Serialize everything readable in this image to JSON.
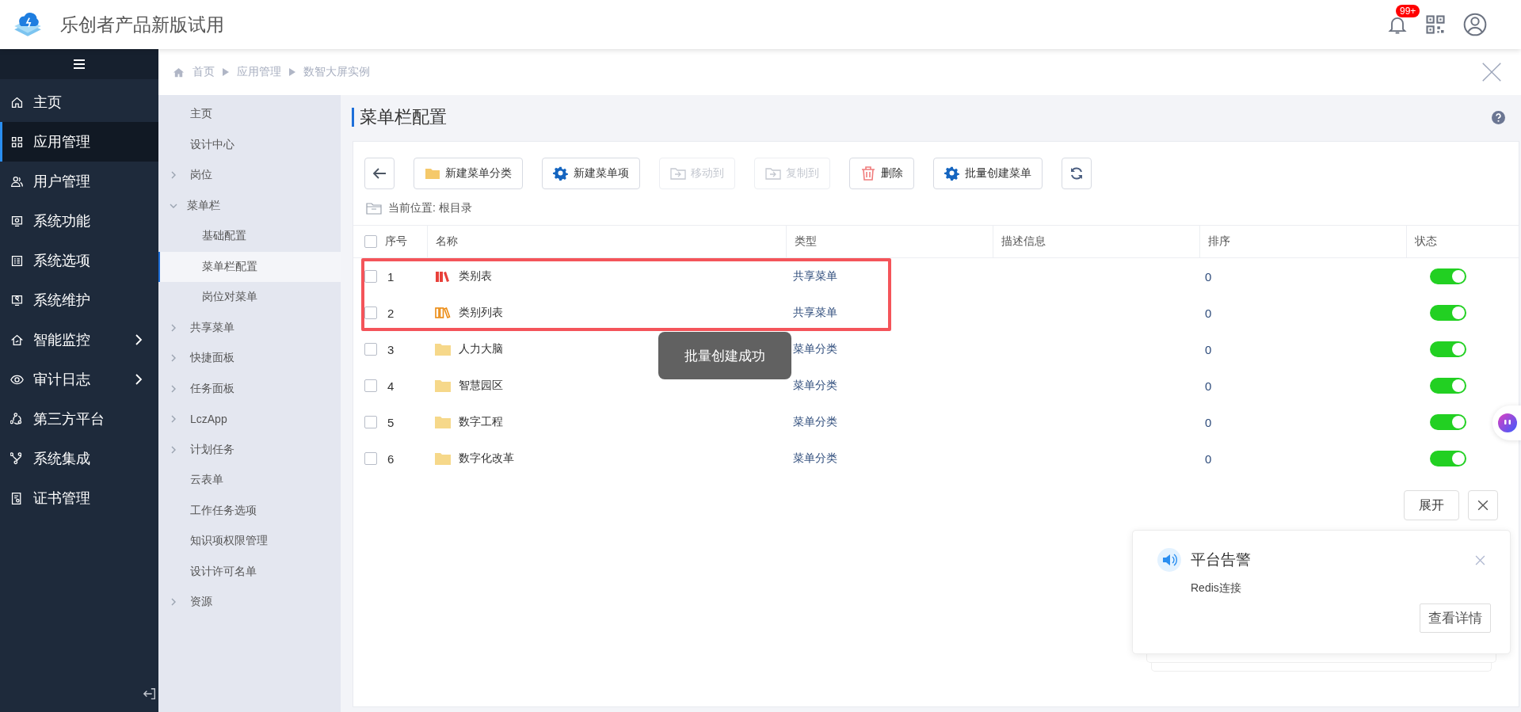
{
  "header": {
    "title": "乐创者产品新版试用",
    "badge": "99+"
  },
  "sidebar": {
    "items": [
      {
        "label": "主页",
        "selected": false,
        "expandable": false
      },
      {
        "label": "应用管理",
        "selected": true,
        "expandable": false
      },
      {
        "label": "用户管理",
        "selected": false,
        "expandable": false
      },
      {
        "label": "系统功能",
        "selected": false,
        "expandable": false
      },
      {
        "label": "系统选项",
        "selected": false,
        "expandable": false
      },
      {
        "label": "系统维护",
        "selected": false,
        "expandable": false
      },
      {
        "label": "智能监控",
        "selected": false,
        "expandable": true
      },
      {
        "label": "审计日志",
        "selected": false,
        "expandable": true
      },
      {
        "label": "第三方平台",
        "selected": false,
        "expandable": false
      },
      {
        "label": "系统集成",
        "selected": false,
        "expandable": false
      },
      {
        "label": "证书管理",
        "selected": false,
        "expandable": false
      }
    ]
  },
  "breadcrumb": [
    "首页",
    "应用管理",
    "数智大屏实例"
  ],
  "submenu": {
    "items": [
      {
        "label": "主页",
        "kind": "page",
        "selected": false
      },
      {
        "label": "设计中心",
        "kind": "page",
        "selected": false
      },
      {
        "label": "岗位",
        "kind": "group",
        "expanded": false,
        "selected": false
      },
      {
        "label": "菜单栏",
        "kind": "group",
        "expanded": true,
        "selected": false,
        "children": [
          {
            "label": "基础配置",
            "selected": false
          },
          {
            "label": "菜单栏配置",
            "selected": true
          },
          {
            "label": "岗位对菜单",
            "selected": false
          }
        ]
      },
      {
        "label": "共享菜单",
        "kind": "group",
        "expanded": false,
        "selected": false
      },
      {
        "label": "快捷面板",
        "kind": "group",
        "expanded": false,
        "selected": false
      },
      {
        "label": "任务面板",
        "kind": "group",
        "expanded": false,
        "selected": false
      },
      {
        "label": "LczApp",
        "kind": "group",
        "expanded": false,
        "selected": false
      },
      {
        "label": "计划任务",
        "kind": "group",
        "expanded": false,
        "selected": false
      },
      {
        "label": "云表单",
        "kind": "page",
        "selected": false
      },
      {
        "label": "工作任务选项",
        "kind": "page",
        "selected": false
      },
      {
        "label": "知识项权限管理",
        "kind": "page",
        "selected": false
      },
      {
        "label": "设计许可名单",
        "kind": "page",
        "selected": false
      },
      {
        "label": "资源",
        "kind": "group",
        "expanded": false,
        "selected": false
      }
    ]
  },
  "page_title": "菜单栏配置",
  "toolbar": [
    {
      "kind": "back",
      "disabled": false
    },
    {
      "kind": "folder",
      "label": "新建菜单分类",
      "disabled": false
    },
    {
      "kind": "gear",
      "label": "新建菜单项",
      "disabled": false
    },
    {
      "kind": "move",
      "label": "移动到",
      "disabled": true
    },
    {
      "kind": "copy",
      "label": "复制到",
      "disabled": true
    },
    {
      "kind": "trash",
      "label": "删除",
      "disabled": false
    },
    {
      "kind": "gear",
      "label": "批量创建菜单",
      "disabled": false
    },
    {
      "kind": "refresh",
      "disabled": false
    }
  ],
  "location": "当前位置: 根目录",
  "table": {
    "all_checked": false,
    "columns": [
      "序号",
      "名称",
      "类型",
      "描述信息",
      "排序",
      "状态"
    ],
    "rows": [
      {
        "index": "1",
        "kind": "books",
        "name": "类别表",
        "type": "共享菜单",
        "order": "0",
        "checked": false,
        "on": true,
        "highlighted": true
      },
      {
        "index": "2",
        "kind": "binders",
        "name": "类别列表",
        "type": "共享菜单",
        "order": "0",
        "checked": false,
        "on": true,
        "highlighted": true
      },
      {
        "index": "3",
        "kind": "folder",
        "name": "人力大脑",
        "type": "菜单分类",
        "order": "0",
        "checked": false,
        "on": true,
        "highlighted": false
      },
      {
        "index": "4",
        "kind": "folder",
        "name": "智慧园区",
        "type": "菜单分类",
        "order": "0",
        "checked": false,
        "on": true,
        "highlighted": false
      },
      {
        "index": "5",
        "kind": "folder",
        "name": "数字工程",
        "type": "菜单分类",
        "order": "0",
        "checked": false,
        "on": true,
        "highlighted": false
      },
      {
        "index": "6",
        "kind": "folder",
        "name": "数字化改革",
        "type": "菜单分类",
        "order": "0",
        "checked": false,
        "on": true,
        "highlighted": false
      }
    ]
  },
  "toast": "批量创建成功",
  "notice_bar": {
    "expand": "展开"
  },
  "notification": {
    "title": "平台告警",
    "body": "Redis连接",
    "action": "查看详情"
  }
}
